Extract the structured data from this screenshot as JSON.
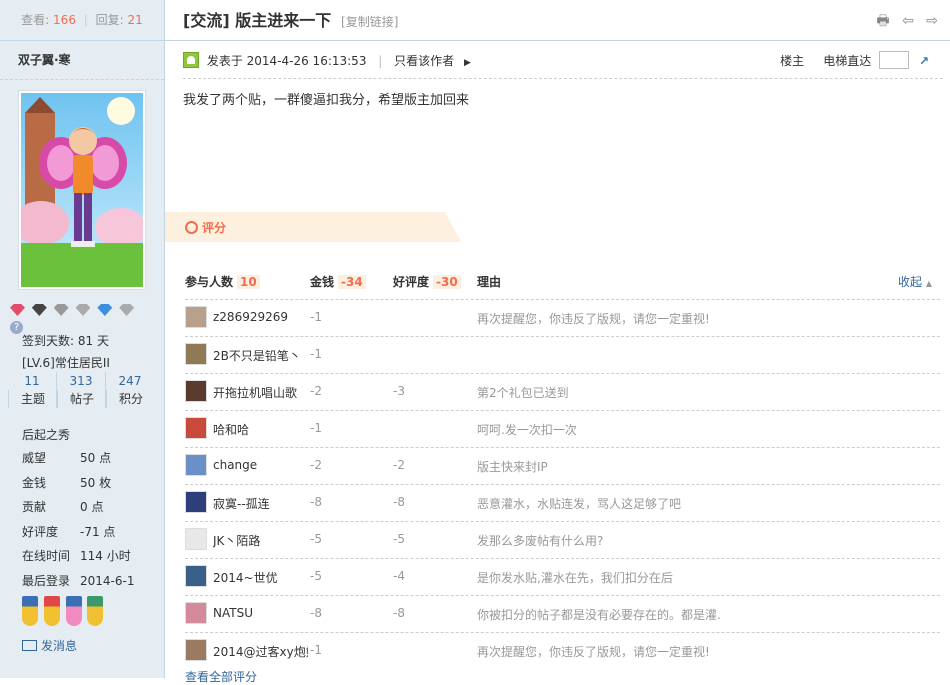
{
  "thread_stats": {
    "views_label": "查看:",
    "views": "166",
    "replies_label": "回复:",
    "replies": "21"
  },
  "author": {
    "name": "双子翼·寒",
    "signin_days": "签到天数: 81 天",
    "level": "[LV.6]常住居民II",
    "stats": [
      {
        "value": "11",
        "label": "主题"
      },
      {
        "value": "313",
        "label": "帖子"
      },
      {
        "value": "247",
        "label": "积分"
      }
    ],
    "group": "后起之秀",
    "details": [
      {
        "key": "威望",
        "value": "50 点"
      },
      {
        "key": "金钱",
        "value": "50 枚"
      },
      {
        "key": "贡献",
        "value": "0 点"
      },
      {
        "key": "好评度",
        "value": "-71 点"
      },
      {
        "key": "在线时间",
        "value": "114 小时"
      },
      {
        "key": "最后登录",
        "value": "2014-6-1"
      }
    ],
    "send_message": "发消息",
    "help_glyph": "?"
  },
  "post": {
    "title": "[交流] 版主进来一下",
    "copy_link": "[复制链接]",
    "toolbar_glyphs": "🖶 ⇦ ⇨",
    "posted_at": "发表于 2014-4-26 16:13:53",
    "only_author": "只看该作者",
    "arrow_glyph": "▶",
    "floor_label": "楼主",
    "jump_label": "电梯直达",
    "jump_go_glyph": "↗",
    "content": "我发了两个贴，一群傻逼扣我分，希望版主加回来"
  },
  "rating": {
    "banner_label": "评分",
    "head_participants": "参与人数",
    "participants": "10",
    "head_money": "金钱",
    "money_total": "-34",
    "head_rep": "好评度",
    "rep_total": "-30",
    "head_reason": "理由",
    "collapse": "收起",
    "collapse_glyph": "▲",
    "view_all": "查看全部评分",
    "rows": [
      {
        "name": "z286929269",
        "money": "-1",
        "rep": "",
        "reason": "再次提醒您，你违反了版规，请您一定重视!",
        "color": "#b9a08a"
      },
      {
        "name": "2B不只是铅笔丶",
        "money": "-1",
        "rep": "",
        "reason": "",
        "color": "#8f7a55"
      },
      {
        "name": "开拖拉机唱山歌",
        "money": "-2",
        "rep": "-3",
        "reason": "第2个礼包已送到",
        "color": "#5a3b2e"
      },
      {
        "name": "哈和哈",
        "money": "-1",
        "rep": "",
        "reason": "呵呵.发一次扣一次",
        "color": "#c94a3a"
      },
      {
        "name": "change",
        "money": "-2",
        "rep": "-2",
        "reason": "版主快来封IP",
        "color": "#6a8fc9"
      },
      {
        "name": "寂寞--孤连",
        "money": "-8",
        "rep": "-8",
        "reason": "恶意灌水，水贴连发，骂人这足够了吧",
        "color": "#2d3e7a"
      },
      {
        "name": "JK丶陌路",
        "money": "-5",
        "rep": "-5",
        "reason": "发那么多废帖有什么用?",
        "color": "#e8e8e8"
      },
      {
        "name": "2014~世优",
        "money": "-5",
        "rep": "-4",
        "reason": "是你发水贴,灌水在先，我们扣分在后",
        "color": "#3a5f8a"
      },
      {
        "name": "NATSU",
        "money": "-8",
        "rep": "-8",
        "reason": "你被扣分的帖子都是没有必要存在的。都是灌.",
        "color": "#d48a9a"
      },
      {
        "name": "2014@过客xy炮姐",
        "money": "-1",
        "rep": "",
        "reason": "再次提醒您，你违反了版规，请您一定重视!",
        "color": "#9a7a60"
      }
    ]
  },
  "colors": {
    "accent": "#f26c4f",
    "link": "#336699",
    "sidebar_bg": "#e5edf2",
    "border": "#c2d5e3"
  }
}
